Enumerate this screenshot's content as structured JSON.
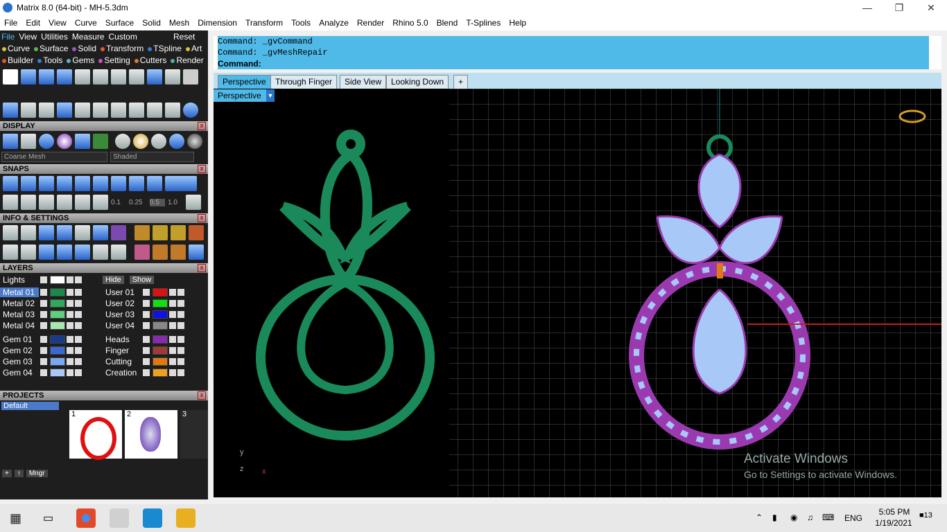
{
  "window": {
    "title": "Matrix 8.0 (64-bit) - MH-5.3dm"
  },
  "menubar": [
    "File",
    "Edit",
    "View",
    "Curve",
    "Surface",
    "Solid",
    "Mesh",
    "Dimension",
    "Transform",
    "Tools",
    "Analyze",
    "Render",
    "Rhino 5.0",
    "Blend",
    "T-Splines",
    "Help"
  ],
  "left_menu": {
    "row1": [
      "File",
      "View",
      "Utilities",
      "Measure",
      "Custom"
    ],
    "reset": "Reset",
    "row2": [
      {
        "label": "Curve",
        "color": "#d7c23a"
      },
      {
        "label": "Surface",
        "color": "#5fb34b"
      },
      {
        "label": "Solid",
        "color": "#9b59b6"
      },
      {
        "label": "Transform",
        "color": "#e05a2a"
      },
      {
        "label": "TSpline",
        "color": "#3a7bd5"
      },
      {
        "label": "Art",
        "color": "#d7c23a"
      }
    ],
    "row3": [
      {
        "label": "Builder",
        "color": "#e05a2a"
      },
      {
        "label": "Tools",
        "color": "#3a7bd5"
      },
      {
        "label": "Gems",
        "color": "#5fb3c8"
      },
      {
        "label": "Setting",
        "color": "#c25ab8"
      },
      {
        "label": "Cutters",
        "color": "#e07a2a"
      },
      {
        "label": "Render",
        "color": "#4bb3a4"
      }
    ]
  },
  "sections": {
    "display": "DISPLAY",
    "snaps": "SNAPS",
    "info": "INFO & SETTINGS",
    "layers": "LAYERS",
    "projects": "PROJECTS"
  },
  "display": {
    "mesh": "Coarse Mesh",
    "shade": "Shaded"
  },
  "snaps": {
    "values": [
      "0.1",
      "0.25",
      "0.5",
      "1.0"
    ]
  },
  "layers": {
    "lights": "Lights",
    "hide": "Hide",
    "show": "Show",
    "left": [
      {
        "name": "Metal 01",
        "color": "#1a8a4a"
      },
      {
        "name": "Metal 02",
        "color": "#2faa5a"
      },
      {
        "name": "Metal 03",
        "color": "#5fcf7a"
      },
      {
        "name": "Metal 04",
        "color": "#a8e8b0"
      },
      {
        "name": "Gem 01",
        "color": "#1a3a8a"
      },
      {
        "name": "Gem 02",
        "color": "#3a6ad0"
      },
      {
        "name": "Gem 03",
        "color": "#7aa8f0"
      },
      {
        "name": "Gem 04",
        "color": "#a8c8f8"
      }
    ],
    "right": [
      {
        "name": "User 01",
        "color": "#e01010"
      },
      {
        "name": "User 02",
        "color": "#10e010"
      },
      {
        "name": "User 03",
        "color": "#1010e0"
      },
      {
        "name": "User 04",
        "color": "#888888"
      },
      {
        "name": "Heads",
        "color": "#8a2ab0"
      },
      {
        "name": "Finger",
        "color": "#a03a3a"
      },
      {
        "name": "Cutting",
        "color": "#e07a10"
      },
      {
        "name": "Creation",
        "color": "#f0a020"
      }
    ]
  },
  "projects": {
    "list": [
      "Default"
    ],
    "thumbs": [
      "1",
      "2",
      "3"
    ],
    "mngr": "Mngr"
  },
  "command": {
    "line1": "Command: _gvCommand",
    "line2": "Command: _gvMeshRepair",
    "prompt": "Command:"
  },
  "tabs": [
    "Perspective",
    "Through Finger",
    "Side View",
    "Looking Down"
  ],
  "viewport": {
    "label": "Perspective",
    "axis_y": "y",
    "axis_z": "z",
    "axis_x": "x"
  },
  "watermark": {
    "line1": "Activate Windows",
    "line2": "Go to Settings to activate Windows."
  },
  "taskbar": {
    "lang": "ENG",
    "time": "5:05 PM",
    "date": "1/19/2021",
    "notif": "13"
  }
}
